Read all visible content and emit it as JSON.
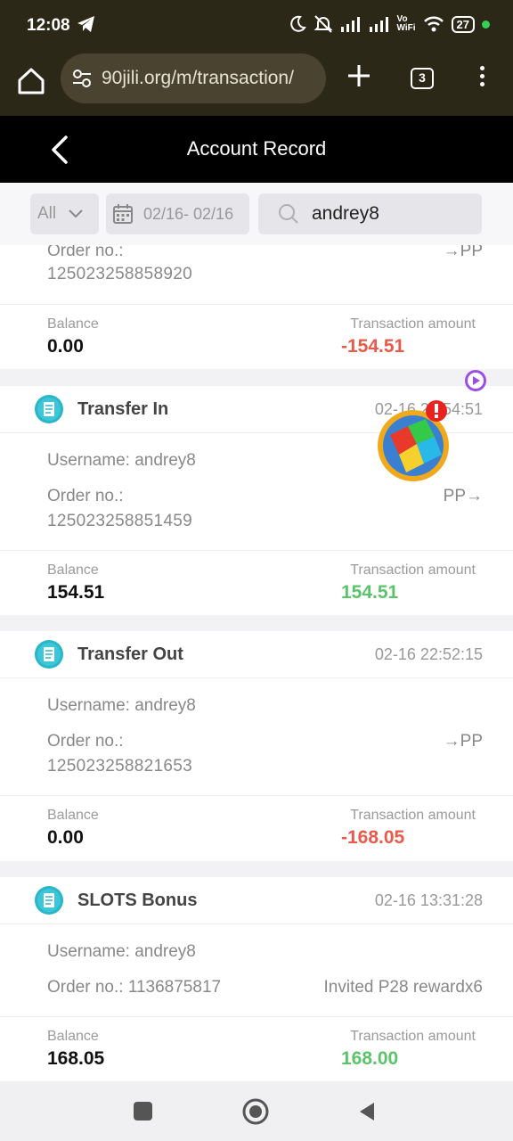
{
  "status_bar": {
    "time": "12:08",
    "battery": "27",
    "volte": "Vo",
    "wifi_label": "WiFi"
  },
  "browser": {
    "url": "90jili.org/m/transaction/",
    "tab_count": "3"
  },
  "header": {
    "title": "Account Record"
  },
  "filters": {
    "type_label": "All",
    "date_range": "02/16- 02/16",
    "search_value": "andrey8"
  },
  "records": [
    {
      "order_label": "Order no.:",
      "order_no": "125023258858920",
      "direction": "→PP",
      "balance_label": "Balance",
      "balance": "0.00",
      "amount_label": "Transaction amount",
      "amount": "-154.51"
    },
    {
      "title": "Transfer In",
      "time": "02-16 22:54:51",
      "username": "Username: andrey8",
      "order_label": "Order no.:",
      "order_no": "125023258851459",
      "direction": "PP→",
      "balance_label": "Balance",
      "balance": "154.51",
      "amount_label": "Transaction amount",
      "amount": "154.51"
    },
    {
      "title": "Transfer Out",
      "time": "02-16 22:52:15",
      "username": "Username: andrey8",
      "order_label": "Order no.:",
      "order_no": "125023258821653",
      "direction": "→PP",
      "balance_label": "Balance",
      "balance": "0.00",
      "amount_label": "Transaction amount",
      "amount": "-168.05"
    },
    {
      "title": "SLOTS Bonus",
      "time": "02-16 13:31:28",
      "username": "Username: andrey8",
      "order_line": "Order no.: 1136875817",
      "note": "Invited P28 rewardx6",
      "balance_label": "Balance",
      "balance": "168.05",
      "amount_label": "Transaction amount",
      "amount": "168.00"
    }
  ],
  "colors": {
    "negative": "#e85a4a",
    "positive": "#5bc46a",
    "icon_teal": "#2bb5c8"
  }
}
